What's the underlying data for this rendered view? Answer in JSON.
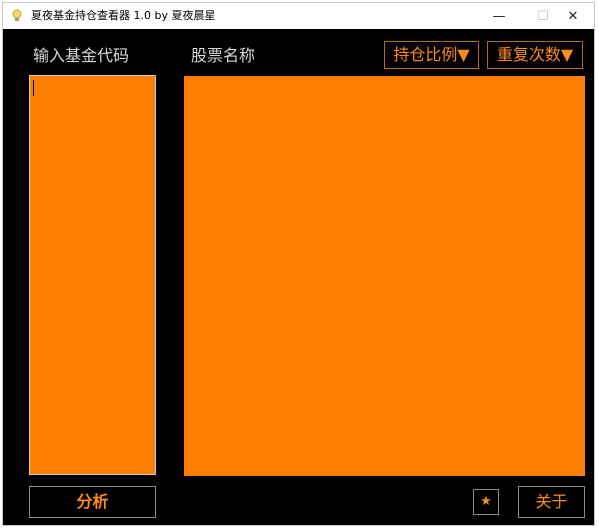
{
  "window": {
    "title": "夏夜基金持仓查看器 1.0     by 夏夜晨星",
    "controls": {
      "minimize": "—",
      "maximize": "☐",
      "close": "✕"
    },
    "icon": "lightbulb-icon"
  },
  "labels": {
    "fund_code": "输入基金代码",
    "stock_name": "股票名称"
  },
  "sort_buttons": {
    "holding_ratio": "持仓比例▼",
    "repeat_count": "重复次数▼"
  },
  "fund_code_input": {
    "value": ""
  },
  "buttons": {
    "analyze": "分析",
    "star": "★",
    "about": "关于"
  },
  "colors": {
    "panel": "#ff8000",
    "accent_text": "#ff8a1c",
    "background": "#000000",
    "label_text": "#d6d6d6"
  }
}
